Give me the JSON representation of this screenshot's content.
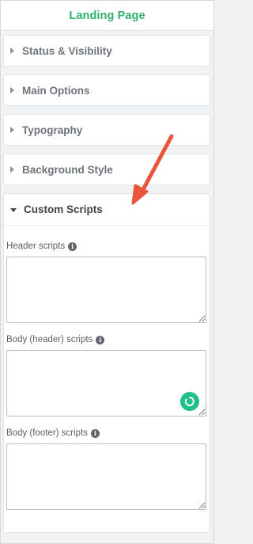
{
  "panel": {
    "title": "Landing Page"
  },
  "sections": [
    {
      "label": "Status & Visibility",
      "expanded": false
    },
    {
      "label": "Main Options",
      "expanded": false
    },
    {
      "label": "Typography",
      "expanded": false
    },
    {
      "label": "Background Style",
      "expanded": false
    },
    {
      "label": "Custom Scripts",
      "expanded": true
    }
  ],
  "custom_scripts": {
    "header_label": "Header scripts",
    "header_value": "",
    "body_header_label": "Body (header) scripts",
    "body_header_value": "",
    "body_footer_label": "Body (footer) scripts",
    "body_footer_value": ""
  },
  "colors": {
    "accent": "#2fb06e",
    "annotation_arrow": "#e8553a",
    "loader": "#1fbf8a"
  },
  "icons": {
    "info": "info-icon",
    "loader": "grammarly-loader-icon",
    "annotation": "red-arrow-annotation"
  }
}
